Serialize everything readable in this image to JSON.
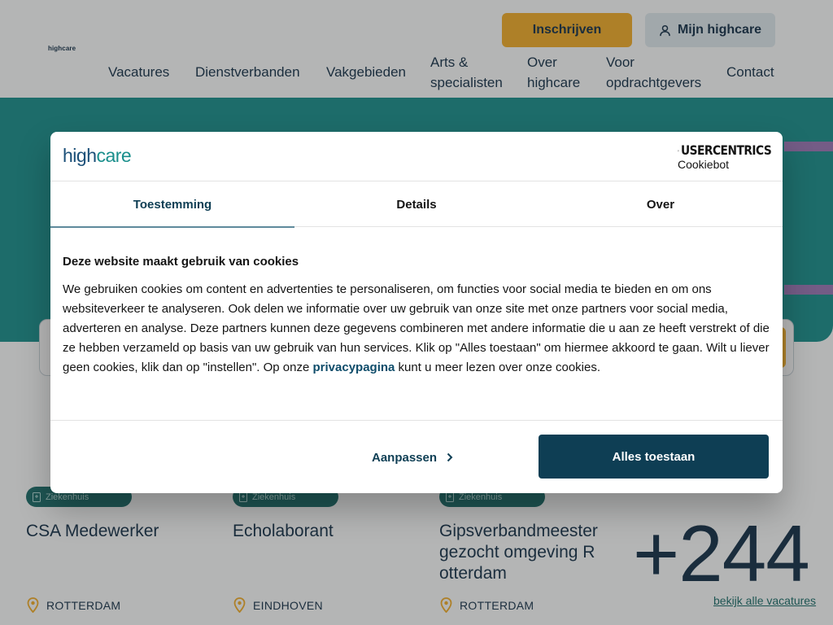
{
  "site": {
    "logo_text": "highcare",
    "header_buttons": {
      "signup_label": "Inschrijven",
      "account_label": "Mijn highcare"
    },
    "nav": [
      {
        "line1": "Vacatures",
        "line2": ""
      },
      {
        "line1": "Dienstverbanden",
        "line2": ""
      },
      {
        "line1": "Vakgebieden",
        "line2": ""
      },
      {
        "line1": "Arts &",
        "line2": "specialisten"
      },
      {
        "line1": "Over",
        "line2": "highcare"
      },
      {
        "line1": "Voor",
        "line2": "opdrachtgevers"
      },
      {
        "line1": "Contact",
        "line2": ""
      }
    ],
    "jobs": [
      {
        "badge": "Ziekenhuis",
        "title": "CSA Medewerker",
        "location": "ROTTERDAM"
      },
      {
        "badge": "Ziekenhuis",
        "title": "Echolaborant",
        "location": "EINDHOVEN"
      },
      {
        "badge": "Ziekenhuis",
        "title": "Gipsverbandmeester gezocht omgeving Rotterdam",
        "location": "ROTTERDAM"
      }
    ],
    "vacancy_count": "+244",
    "all_vacancies_link": "bekijk alle vacatures",
    "colors": {
      "primary_dark": "#16324a",
      "teal": "#1a8f8c",
      "accent_yellow": "#f2ad2a"
    }
  },
  "cookie_dialog": {
    "brand_logo": {
      "part1": "high",
      "part2": "care"
    },
    "provider_name": "USERCENTRICS",
    "provider_product": "Cookiebot",
    "tabs": [
      {
        "label": "Toestemming",
        "active": true
      },
      {
        "label": "Details",
        "active": false
      },
      {
        "label": "Over",
        "active": false
      }
    ],
    "heading": "Deze website maakt gebruik van cookies",
    "body_before_link": "We gebruiken cookies om content en advertenties te personaliseren, om functies voor social media te bieden en om ons websiteverkeer te analyseren. Ook delen we informatie over uw gebruik van onze site met onze partners voor social media, adverteren en analyse. Deze partners kunnen deze gegevens combineren met andere informatie die u aan ze heeft verstrekt of die ze hebben verzameld op basis van uw gebruik van hun services. Klik op \"Alles toestaan\" om hiermee akkoord te gaan. Wilt u liever geen cookies, klik dan op \"instellen\". Op onze ",
    "privacy_link": "privacypagina",
    "body_after_link": " kunt u meer lezen over onze cookies.",
    "customize_label": "Aanpassen",
    "allow_all_label": "Alles toestaan",
    "colors": {
      "button_bg": "#0e3e54",
      "tab_indicator": "#5e8a9c"
    }
  }
}
